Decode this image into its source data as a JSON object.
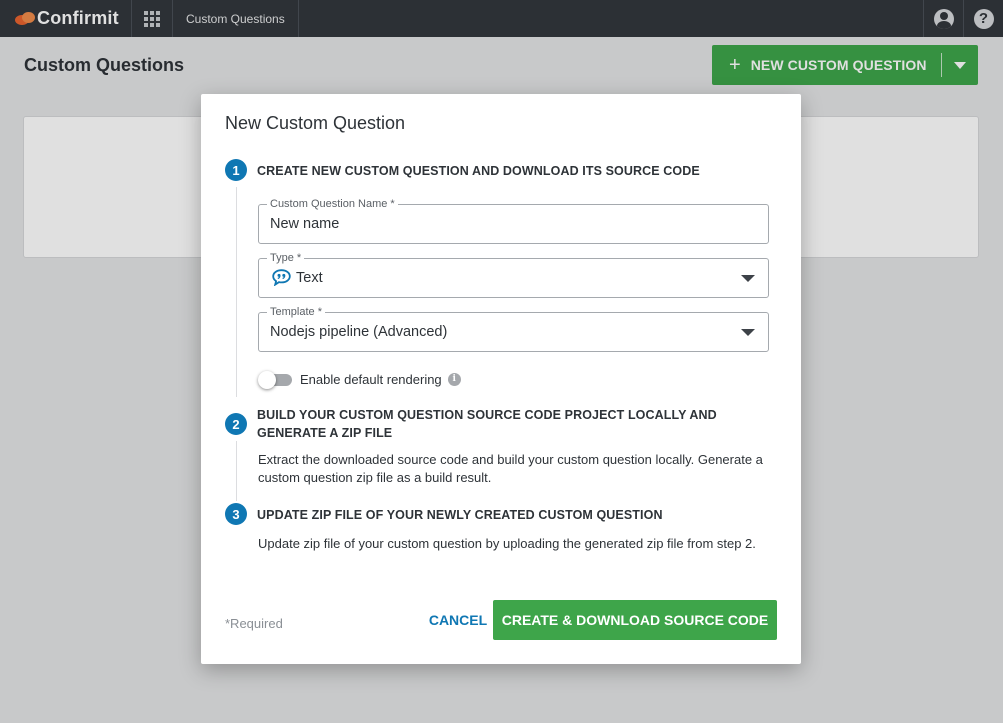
{
  "topbar": {
    "logo_text": "Confirmit",
    "apps_icon": "apps-grid-icon",
    "tab_label": "Custom Questions",
    "user_icon": "account-icon",
    "help_icon": "help-icon",
    "help_glyph": "?"
  },
  "page": {
    "title": "Custom Questions",
    "new_button_label": "NEW CUSTOM QUESTION",
    "plus_glyph": "+"
  },
  "modal": {
    "title": "New Custom Question",
    "steps": [
      {
        "number": "1",
        "title": "CREATE NEW CUSTOM QUESTION AND DOWNLOAD ITS SOURCE CODE"
      },
      {
        "number": "2",
        "title": "BUILD YOUR CUSTOM QUESTION SOURCE CODE PROJECT LOCALLY AND GENERATE A ZIP FILE",
        "description": "Extract the downloaded source code and build your custom question locally. Generate a custom question zip file as a build result."
      },
      {
        "number": "3",
        "title": "UPDATE ZIP FILE OF YOUR NEWLY CREATED CUSTOM QUESTION",
        "description": "Update zip file of your custom question by uploading the generated zip file from step 2."
      }
    ],
    "fields": {
      "name": {
        "label": "Custom Question Name *",
        "value": "New name"
      },
      "type": {
        "label": "Type *",
        "value": "Text",
        "icon": "speech-bubble-quote-icon"
      },
      "template": {
        "label": "Template *",
        "value": "Nodejs pipeline (Advanced)"
      }
    },
    "toggle": {
      "label": "Enable default rendering",
      "enabled": false,
      "info_glyph": "i"
    },
    "required_note": "*Required",
    "cancel_label": "CANCEL",
    "create_label": "CREATE & DOWNLOAD SOURCE CODE"
  },
  "colors": {
    "topbar_bg": "#33373d",
    "primary_green": "#3ea54a",
    "step_blue": "#0f77b3",
    "link_blue": "#0f77b3",
    "page_bg": "#e4e5e6"
  }
}
